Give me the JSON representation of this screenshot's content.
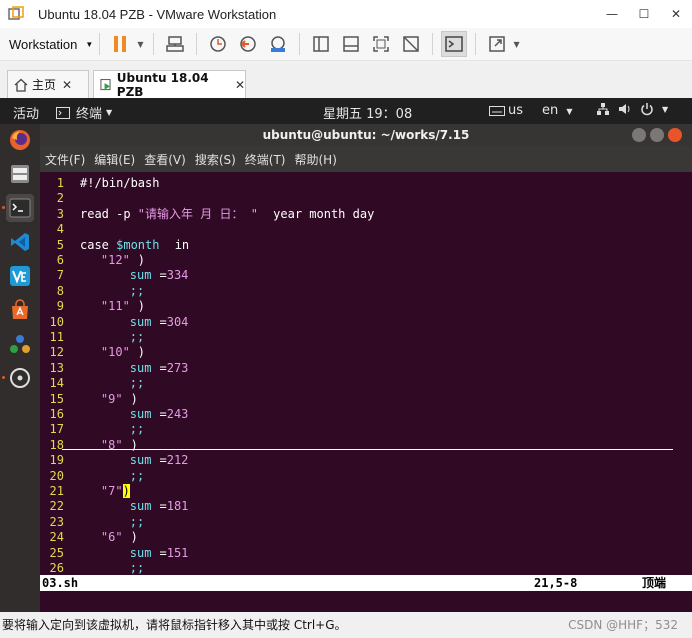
{
  "window": {
    "title": "Ubuntu 18.04 PZB - VMware Workstation",
    "minimize": "—",
    "maximize": "☐",
    "close": "✕"
  },
  "toolbar": {
    "menu_label": "Workstation"
  },
  "tabs": [
    {
      "label": "主页"
    },
    {
      "label": "Ubuntu 18.04 PZB"
    }
  ],
  "ubuntu": {
    "activities": "活动",
    "app_menu": "终端",
    "clock": "星期五 19：08",
    "keyboard": "us",
    "language": "en"
  },
  "terminal": {
    "title": "ubuntu@ubuntu: ~/works/7.15",
    "menu": [
      "文件(F)",
      "编辑(E)",
      "查看(V)",
      "搜索(S)",
      "终端(T)",
      "帮助(H)"
    ]
  },
  "editor": {
    "lines": [
      {
        "n": "1",
        "segments": [
          [
            "txt",
            "#!/bin/bash"
          ]
        ]
      },
      {
        "n": "2",
        "segments": [
          [
            "txt",
            ""
          ]
        ]
      },
      {
        "n": "3",
        "segments": [
          [
            "txt",
            "read -p "
          ],
          [
            "str",
            "\"请输入年 月 日： \""
          ],
          [
            "txt",
            " year month day"
          ]
        ]
      },
      {
        "n": "4",
        "segments": [
          [
            "txt",
            ""
          ]
        ]
      },
      {
        "n": "5",
        "segments": [
          [
            "txt",
            "case "
          ],
          [
            "var",
            "$month"
          ],
          [
            "txt",
            " in"
          ]
        ]
      },
      {
        "n": "6",
        "segments": [
          [
            "str",
            "    \"12\""
          ],
          [
            "txt",
            ")"
          ]
        ]
      },
      {
        "n": "7",
        "segments": [
          [
            "tok-sum",
            "        sum"
          ],
          [
            "txt",
            "="
          ],
          [
            "num",
            "334"
          ]
        ]
      },
      {
        "n": "8",
        "segments": [
          [
            "semi",
            "        ;;"
          ]
        ]
      },
      {
        "n": "9",
        "segments": [
          [
            "str",
            "    \"11\""
          ],
          [
            "txt",
            ")"
          ]
        ]
      },
      {
        "n": "10",
        "segments": [
          [
            "tok-sum",
            "        sum"
          ],
          [
            "txt",
            "="
          ],
          [
            "num",
            "304"
          ]
        ]
      },
      {
        "n": "11",
        "segments": [
          [
            "semi",
            "        ;;"
          ]
        ]
      },
      {
        "n": "12",
        "segments": [
          [
            "str",
            "    \"10\""
          ],
          [
            "txt",
            ")"
          ]
        ]
      },
      {
        "n": "13",
        "segments": [
          [
            "tok-sum",
            "        sum"
          ],
          [
            "txt",
            "="
          ],
          [
            "num",
            "273"
          ]
        ]
      },
      {
        "n": "14",
        "segments": [
          [
            "semi",
            "        ;;"
          ]
        ]
      },
      {
        "n": "15",
        "segments": [
          [
            "str",
            "    \"9\""
          ],
          [
            "txt",
            ")"
          ]
        ]
      },
      {
        "n": "16",
        "segments": [
          [
            "tok-sum",
            "        sum"
          ],
          [
            "txt",
            "="
          ],
          [
            "num",
            "243"
          ]
        ]
      },
      {
        "n": "17",
        "segments": [
          [
            "semi",
            "        ;;"
          ]
        ]
      },
      {
        "n": "18",
        "segments": [
          [
            "str",
            "    \"8\""
          ],
          [
            "txt",
            ")"
          ]
        ]
      },
      {
        "n": "19",
        "segments": [
          [
            "tok-sum",
            "        sum"
          ],
          [
            "txt",
            "="
          ],
          [
            "num",
            "212"
          ]
        ]
      },
      {
        "n": "20",
        "segments": [
          [
            "semi",
            "        ;;"
          ]
        ]
      },
      {
        "n": "21",
        "segments": [
          [
            "str",
            "    \"7\""
          ],
          [
            "cursor",
            ")"
          ]
        ]
      },
      {
        "n": "22",
        "segments": [
          [
            "tok-sum",
            "        sum"
          ],
          [
            "txt",
            "="
          ],
          [
            "num",
            "181"
          ]
        ]
      },
      {
        "n": "23",
        "segments": [
          [
            "semi",
            "        ;;"
          ]
        ]
      },
      {
        "n": "24",
        "segments": [
          [
            "str",
            "    \"6\""
          ],
          [
            "txt",
            ")"
          ]
        ]
      },
      {
        "n": "25",
        "segments": [
          [
            "tok-sum",
            "        sum"
          ],
          [
            "txt",
            "="
          ],
          [
            "num",
            "151"
          ]
        ]
      },
      {
        "n": "26",
        "segments": [
          [
            "semi",
            "        ;;"
          ]
        ]
      }
    ],
    "status_file": "03.sh",
    "status_pos": "21,5-8",
    "status_top": "顶端"
  },
  "statusbar": {
    "message": "要将输入定向到该虚拟机，请将鼠标指针移入其中或按 Ctrl+G。",
    "watermark": "CSDN @HHF；532"
  },
  "colors": {
    "terminal_bg": "#300a24",
    "line_number": "#e4d84f",
    "variable": "#6fe0e8",
    "string": "#e59ae5",
    "ubuntu_orange": "#e95420"
  }
}
